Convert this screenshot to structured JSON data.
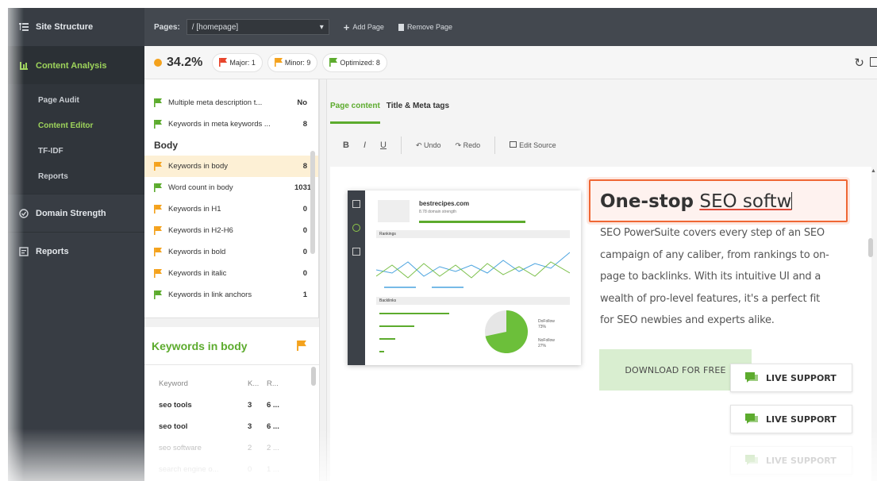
{
  "sidebar": {
    "site_structure": "Site Structure",
    "content_analysis": "Content Analysis",
    "sub_items": [
      "Page Audit",
      "Content Editor",
      "TF-IDF",
      "Reports"
    ],
    "domain_strength": "Domain Strength",
    "reports": "Reports"
  },
  "topbar": {
    "pages_label": "Pages:",
    "page_value": "/ [homepage]",
    "add_page": "Add Page",
    "remove_page": "Remove Page"
  },
  "scorebar": {
    "score": "34.2%",
    "major": "Major: 1",
    "minor": "Minor: 9",
    "optimized": "Optimized: 8"
  },
  "checklist": {
    "top_items": [
      {
        "label": "Multiple meta description t...",
        "value": "No",
        "status": "green"
      },
      {
        "label": "Keywords in meta keywords ...",
        "value": "8",
        "status": "green"
      }
    ],
    "body_heading": "Body",
    "body_items": [
      {
        "label": "Keywords in body",
        "value": "8",
        "status": "orange"
      },
      {
        "label": "Word count in body",
        "value": "1031",
        "status": "green"
      },
      {
        "label": "Keywords in H1",
        "value": "0",
        "status": "orange"
      },
      {
        "label": "Keywords in H2-H6",
        "value": "0",
        "status": "orange"
      },
      {
        "label": "Keywords in bold",
        "value": "0",
        "status": "orange"
      },
      {
        "label": "Keywords in italic",
        "value": "0",
        "status": "orange"
      },
      {
        "label": "Keywords in link anchors",
        "value": "1",
        "status": "green"
      }
    ]
  },
  "keywords_panel": {
    "title": "Keywords in body",
    "headers": [
      "Keyword",
      "K...",
      "R..."
    ],
    "rows": [
      [
        "seo tools",
        "3",
        "6 ..."
      ],
      [
        "seo tool",
        "3",
        "6 ..."
      ],
      [
        "seo software",
        "2",
        "2 ..."
      ],
      [
        "search engine o...",
        "0",
        "1 ..."
      ]
    ]
  },
  "editor": {
    "tabs": [
      "Page content",
      "Title & Meta tags"
    ],
    "toolbar": {
      "bold": "B",
      "italic": "I",
      "underline": "U",
      "undo": "Undo",
      "redo": "Redo",
      "edit_source": "Edit Source"
    },
    "mock": {
      "site": "bestrecipes.com",
      "sub": "8.78 domain strength",
      "rankings": "Rankings",
      "backlinks": "Backlinks",
      "legend1": "DoFollow",
      "legend1_pct": "73%",
      "legend2": "NoFollow",
      "legend2_pct": "27%"
    },
    "headline_bold": "One-stop",
    "headline_rest": "SEO softw",
    "paragraph_lines": [
      "SEO PowerSuite covers every step of an SEO",
      "campaign of any caliber, from rankings to on-",
      "page to backlinks. With its intuitive UI and a",
      "wealth of pro-level features, it's a perfect fit",
      "for SEO newbies and experts alike."
    ],
    "download": "DOWNLOAD FOR FREE",
    "live_support": "LIVE SUPPORT"
  },
  "colors": {
    "accent_green": "#5cab2d",
    "orange": "#f4a21d",
    "red": "#e8452c",
    "sidebar": "#383d44"
  }
}
